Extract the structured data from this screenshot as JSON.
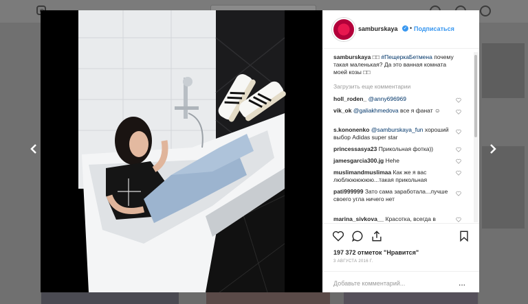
{
  "post": {
    "username": "samburskaya",
    "follow_label": "Подписаться",
    "caption_user": "samburskaya",
    "caption_emoji": "□□",
    "caption_hashtag": "#ПещеркаБетмена",
    "caption_text": "почему такая маленькая? Да это ванная комната моей козы □□",
    "load_more": "Загрузить еще комментарии",
    "likes": "197 372 отметок \"Нравится\"",
    "date": "3 АВГУСТА 2016 Г.",
    "add_comment_placeholder": "Добавьте комментарий...",
    "more_options": "..."
  },
  "comments": [
    {
      "user": "holl_roden_",
      "mention": "@anny696969",
      "text": ""
    },
    {
      "user": "vik_ok",
      "mention": "@galiakhmedova",
      "text": "все я фанат ☺"
    },
    {
      "user": "s.kononenko",
      "mention": "@samburskaya_fun",
      "text": "хороший выбор Adidas super star"
    },
    {
      "user": "princessasya23",
      "mention": "",
      "text": "Прикольная фотка))"
    },
    {
      "user": "jamesgarcia300.jg",
      "mention": "",
      "text": "Hehe"
    },
    {
      "user": "muslimandmuslimaa",
      "mention": "",
      "text": "Как же я вас люблюююююю...такая прикольная"
    },
    {
      "user": "pati999999",
      "mention": "",
      "text": "Зато сама заработала...лучше своего угла ничего нет"
    },
    {
      "user": "marina_sivkova__",
      "mention": "",
      "text": "Красотка, всегда в"
    }
  ],
  "colors": {
    "accent": "#3897f0",
    "text": "#262626",
    "muted": "#999999"
  }
}
